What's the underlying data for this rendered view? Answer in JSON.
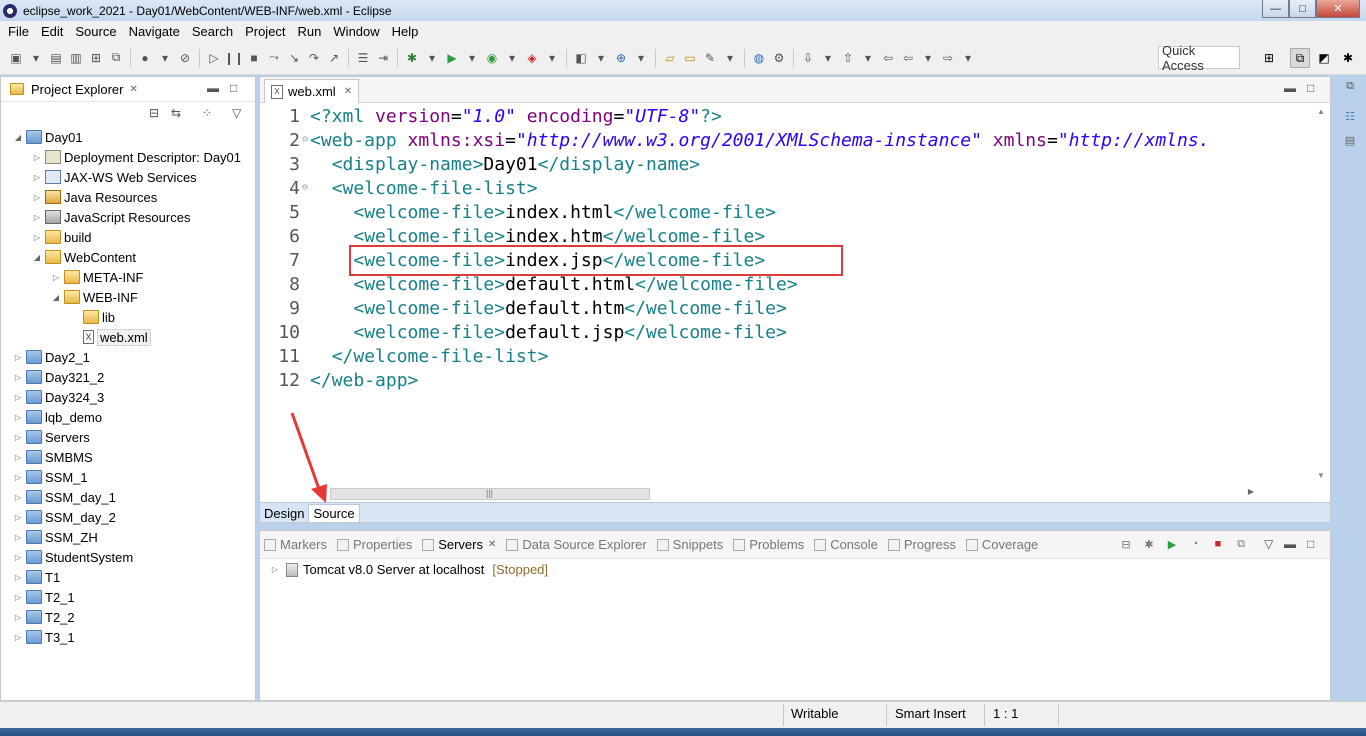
{
  "window": {
    "title": "eclipse_work_2021 - Day01/WebContent/WEB-INF/web.xml - Eclipse",
    "min": "—",
    "max": "□",
    "close": "✕"
  },
  "menu": [
    "File",
    "Edit",
    "Source",
    "Navigate",
    "Search",
    "Project",
    "Run",
    "Window",
    "Help"
  ],
  "toolbar": {
    "quick_access": "Quick Access"
  },
  "explorer": {
    "title": "Project Explorer",
    "close": "✕",
    "tree": [
      {
        "label": "Day01",
        "depth": 0,
        "expanded": true,
        "icon": "project"
      },
      {
        "label": "Deployment Descriptor: Day01",
        "depth": 1,
        "expanded": false,
        "icon": "desc"
      },
      {
        "label": "JAX-WS Web Services",
        "depth": 1,
        "expanded": false,
        "icon": "ws"
      },
      {
        "label": "Java Resources",
        "depth": 1,
        "expanded": false,
        "icon": "java"
      },
      {
        "label": "JavaScript Resources",
        "depth": 1,
        "expanded": false,
        "icon": "js"
      },
      {
        "label": "build",
        "depth": 1,
        "expanded": false,
        "icon": "folder"
      },
      {
        "label": "WebContent",
        "depth": 1,
        "expanded": true,
        "icon": "folder"
      },
      {
        "label": "META-INF",
        "depth": 2,
        "expanded": false,
        "icon": "folder"
      },
      {
        "label": "WEB-INF",
        "depth": 2,
        "expanded": true,
        "icon": "folder"
      },
      {
        "label": "lib",
        "depth": 3,
        "expanded": null,
        "icon": "folder"
      },
      {
        "label": "web.xml",
        "depth": 3,
        "expanded": null,
        "icon": "xml",
        "selected": true
      },
      {
        "label": "Day2_1",
        "depth": 0,
        "expanded": false,
        "icon": "project"
      },
      {
        "label": "Day321_2",
        "depth": 0,
        "expanded": false,
        "icon": "project"
      },
      {
        "label": "Day324_3",
        "depth": 0,
        "expanded": false,
        "icon": "project"
      },
      {
        "label": "lqb_demo",
        "depth": 0,
        "expanded": false,
        "icon": "project"
      },
      {
        "label": "Servers",
        "depth": 0,
        "expanded": false,
        "icon": "project"
      },
      {
        "label": "SMBMS",
        "depth": 0,
        "expanded": false,
        "icon": "project"
      },
      {
        "label": "SSM_1",
        "depth": 0,
        "expanded": false,
        "icon": "project"
      },
      {
        "label": "SSM_day_1",
        "depth": 0,
        "expanded": false,
        "icon": "project"
      },
      {
        "label": "SSM_day_2",
        "depth": 0,
        "expanded": false,
        "icon": "project"
      },
      {
        "label": "SSM_ZH",
        "depth": 0,
        "expanded": false,
        "icon": "project"
      },
      {
        "label": "StudentSystem",
        "depth": 0,
        "expanded": false,
        "icon": "project"
      },
      {
        "label": "T1",
        "depth": 0,
        "expanded": false,
        "icon": "project"
      },
      {
        "label": "T2_1",
        "depth": 0,
        "expanded": false,
        "icon": "project"
      },
      {
        "label": "T2_2",
        "depth": 0,
        "expanded": false,
        "icon": "project"
      },
      {
        "label": "T3_1",
        "depth": 0,
        "expanded": false,
        "icon": "project"
      }
    ]
  },
  "editor": {
    "tab_label": "web.xml",
    "xml_badge": "X",
    "close": "✕",
    "lines": [
      {
        "num": "1",
        "fold": "",
        "indent": "",
        "parts": [
          [
            "pi",
            "<?xml "
          ],
          [
            "attr",
            "version"
          ],
          [
            "txt",
            "="
          ],
          [
            "str",
            "\"1.0\""
          ],
          [
            "txt",
            " "
          ],
          [
            "attr",
            "encoding"
          ],
          [
            "txt",
            "="
          ],
          [
            "str",
            "\"UTF-8\""
          ],
          [
            "pi",
            "?>"
          ]
        ]
      },
      {
        "num": "2",
        "fold": "⊖",
        "indent": "",
        "parts": [
          [
            "tag",
            "<web-app "
          ],
          [
            "attr",
            "xmlns:xsi"
          ],
          [
            "txt",
            "="
          ],
          [
            "str",
            "\"http://www.w3.org/2001/XMLSchema-instance\""
          ],
          [
            "txt",
            " "
          ],
          [
            "attr",
            "xmlns"
          ],
          [
            "txt",
            "="
          ],
          [
            "str",
            "\"http://xmlns."
          ]
        ]
      },
      {
        "num": "3",
        "fold": "",
        "indent": "  ",
        "parts": [
          [
            "tag",
            "<display-name>"
          ],
          [
            "txt",
            "Day01"
          ],
          [
            "tag",
            "</display-name>"
          ]
        ]
      },
      {
        "num": "4",
        "fold": "⊖",
        "indent": "  ",
        "parts": [
          [
            "tag",
            "<welcome-file-list>"
          ]
        ]
      },
      {
        "num": "5",
        "fold": "",
        "indent": "    ",
        "parts": [
          [
            "tag",
            "<welcome-file>"
          ],
          [
            "txt",
            "index.html"
          ],
          [
            "tag",
            "</welcome-file>"
          ]
        ]
      },
      {
        "num": "6",
        "fold": "",
        "indent": "    ",
        "parts": [
          [
            "tag",
            "<welcome-file>"
          ],
          [
            "txt",
            "index.htm"
          ],
          [
            "tag",
            "</welcome-file>"
          ]
        ]
      },
      {
        "num": "7",
        "fold": "",
        "indent": "    ",
        "parts": [
          [
            "tag",
            "<welcome-file>"
          ],
          [
            "txt",
            "index.jsp"
          ],
          [
            "tag",
            "</welcome-file>"
          ]
        ]
      },
      {
        "num": "8",
        "fold": "",
        "indent": "    ",
        "parts": [
          [
            "tag",
            "<welcome-file>"
          ],
          [
            "txt",
            "default.html"
          ],
          [
            "tag",
            "</welcome-file>"
          ]
        ]
      },
      {
        "num": "9",
        "fold": "",
        "indent": "    ",
        "parts": [
          [
            "tag",
            "<welcome-file>"
          ],
          [
            "txt",
            "default.htm"
          ],
          [
            "tag",
            "</welcome-file>"
          ]
        ]
      },
      {
        "num": "10",
        "fold": "",
        "indent": "    ",
        "parts": [
          [
            "tag",
            "<welcome-file>"
          ],
          [
            "txt",
            "default.jsp"
          ],
          [
            "tag",
            "</welcome-file>"
          ]
        ]
      },
      {
        "num": "11",
        "fold": "",
        "indent": "  ",
        "parts": [
          [
            "tag",
            "</welcome-file-list>"
          ]
        ]
      },
      {
        "num": "12",
        "fold": "",
        "indent": "",
        "parts": [
          [
            "tag",
            "</web-app>"
          ]
        ]
      }
    ],
    "design_tab": "Design",
    "source_tab": "Source",
    "hscroll_grip": "|||"
  },
  "bottom": {
    "tabs": [
      {
        "label": "Markers",
        "active": false
      },
      {
        "label": "Properties",
        "active": false
      },
      {
        "label": "Servers",
        "active": true
      },
      {
        "label": "Data Source Explorer",
        "active": false
      },
      {
        "label": "Snippets",
        "active": false
      },
      {
        "label": "Problems",
        "active": false
      },
      {
        "label": "Console",
        "active": false
      },
      {
        "label": "Progress",
        "active": false
      },
      {
        "label": "Coverage",
        "active": false
      }
    ],
    "close": "✕",
    "server": {
      "name": "Tomcat v8.0 Server at localhost",
      "status": "[Stopped]"
    }
  },
  "statusbar": {
    "writable": "Writable",
    "insert_mode": "Smart Insert",
    "position": "1 : 1"
  },
  "colors": {
    "tag": "#17808a",
    "attr": "#7f007f",
    "string": "#2a00ff",
    "highlight": "#e03a3a"
  }
}
